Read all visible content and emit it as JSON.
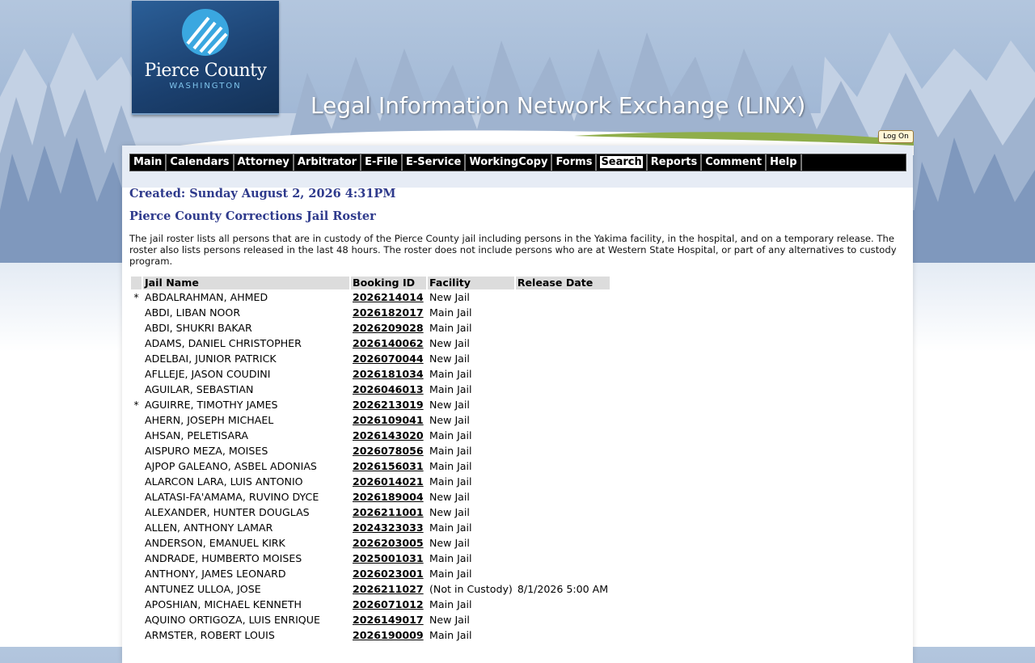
{
  "logo": {
    "name": "Pierce County",
    "state": "WASHINGTON"
  },
  "site_title": "Legal Information Network Exchange (LINX)",
  "logon_label": "Log On",
  "nav": [
    "Main",
    "Calendars",
    "Attorney",
    "Arbitrator",
    "E-File",
    "E-Service",
    "WorkingCopy",
    "Forms",
    "Search",
    "Reports",
    "Comment",
    "Help"
  ],
  "nav_active": "Search",
  "created": "Created: Sunday August 2, 2026 4:31PM",
  "roster_title": "Pierce County Corrections Jail Roster",
  "description": "The jail roster lists all persons that are in custody of the Pierce County jail including persons in the Yakima facility, in the hospital, and on a temporary release. The roster also lists persons released in the last 48 hours. The roster does not include persons who are at Western State Hospital, or part of any alternatives to custody program.",
  "columns": [
    "Jail Name",
    "Booking ID",
    "Facility",
    "Release Date"
  ],
  "rows": [
    {
      "star": "*",
      "name": "ABDALRAHMAN, AHMED",
      "id": "2026214014",
      "facility": "New Jail",
      "release": ""
    },
    {
      "star": "",
      "name": "ABDI, LIBAN NOOR",
      "id": "2026182017",
      "facility": "Main Jail",
      "release": ""
    },
    {
      "star": "",
      "name": "ABDI, SHUKRI BAKAR",
      "id": "2026209028",
      "facility": "Main Jail",
      "release": ""
    },
    {
      "star": "",
      "name": "ADAMS, DANIEL CHRISTOPHER",
      "id": "2026140062",
      "facility": "New Jail",
      "release": ""
    },
    {
      "star": "",
      "name": "ADELBAI, JUNIOR PATRICK",
      "id": "2026070044",
      "facility": "New Jail",
      "release": ""
    },
    {
      "star": "",
      "name": "AFLLEJE, JASON COUDINI",
      "id": "2026181034",
      "facility": "Main Jail",
      "release": ""
    },
    {
      "star": "",
      "name": "AGUILAR, SEBASTIAN",
      "id": "2026046013",
      "facility": "Main Jail",
      "release": ""
    },
    {
      "star": "*",
      "name": "AGUIRRE, TIMOTHY JAMES",
      "id": "2026213019",
      "facility": "New Jail",
      "release": ""
    },
    {
      "star": "",
      "name": "AHERN, JOSEPH MICHAEL",
      "id": "2026109041",
      "facility": "New Jail",
      "release": ""
    },
    {
      "star": "",
      "name": "AHSAN, PELETISARA",
      "id": "2026143020",
      "facility": "Main Jail",
      "release": ""
    },
    {
      "star": "",
      "name": "AISPURO MEZA, MOISES",
      "id": "2026078056",
      "facility": "Main Jail",
      "release": ""
    },
    {
      "star": "",
      "name": "AJPOP GALEANO, ASBEL ADONIAS",
      "id": "2026156031",
      "facility": "Main Jail",
      "release": ""
    },
    {
      "star": "",
      "name": "ALARCON LARA, LUIS ANTONIO",
      "id": "2026014021",
      "facility": "Main Jail",
      "release": ""
    },
    {
      "star": "",
      "name": "ALATASI-FA'AMAMA, RUVINO DYCE",
      "id": "2026189004",
      "facility": "New Jail",
      "release": ""
    },
    {
      "star": "",
      "name": "ALEXANDER, HUNTER DOUGLAS",
      "id": "2026211001",
      "facility": "New Jail",
      "release": ""
    },
    {
      "star": "",
      "name": "ALLEN, ANTHONY LAMAR",
      "id": "2024323033",
      "facility": "Main Jail",
      "release": ""
    },
    {
      "star": "",
      "name": "ANDERSON, EMANUEL KIRK",
      "id": "2026203005",
      "facility": "New Jail",
      "release": ""
    },
    {
      "star": "",
      "name": "ANDRADE, HUMBERTO MOISES",
      "id": "2025001031",
      "facility": "Main Jail",
      "release": ""
    },
    {
      "star": "",
      "name": "ANTHONY, JAMES LEONARD",
      "id": "2026023001",
      "facility": "Main Jail",
      "release": ""
    },
    {
      "star": "",
      "name": "ANTUNEZ ULLOA, JOSE",
      "id": "2026211027",
      "facility": "(Not in Custody)",
      "release": "8/1/2026 5:00 AM"
    },
    {
      "star": "",
      "name": "APOSHIAN, MICHAEL KENNETH",
      "id": "2026071012",
      "facility": "Main Jail",
      "release": ""
    },
    {
      "star": "",
      "name": "AQUINO ORTIGOZA, LUIS ENRIQUE",
      "id": "2026149017",
      "facility": "New Jail",
      "release": ""
    },
    {
      "star": "",
      "name": "ARMSTER, ROBERT LOUIS",
      "id": "2026190009",
      "facility": "Main Jail",
      "release": ""
    }
  ]
}
